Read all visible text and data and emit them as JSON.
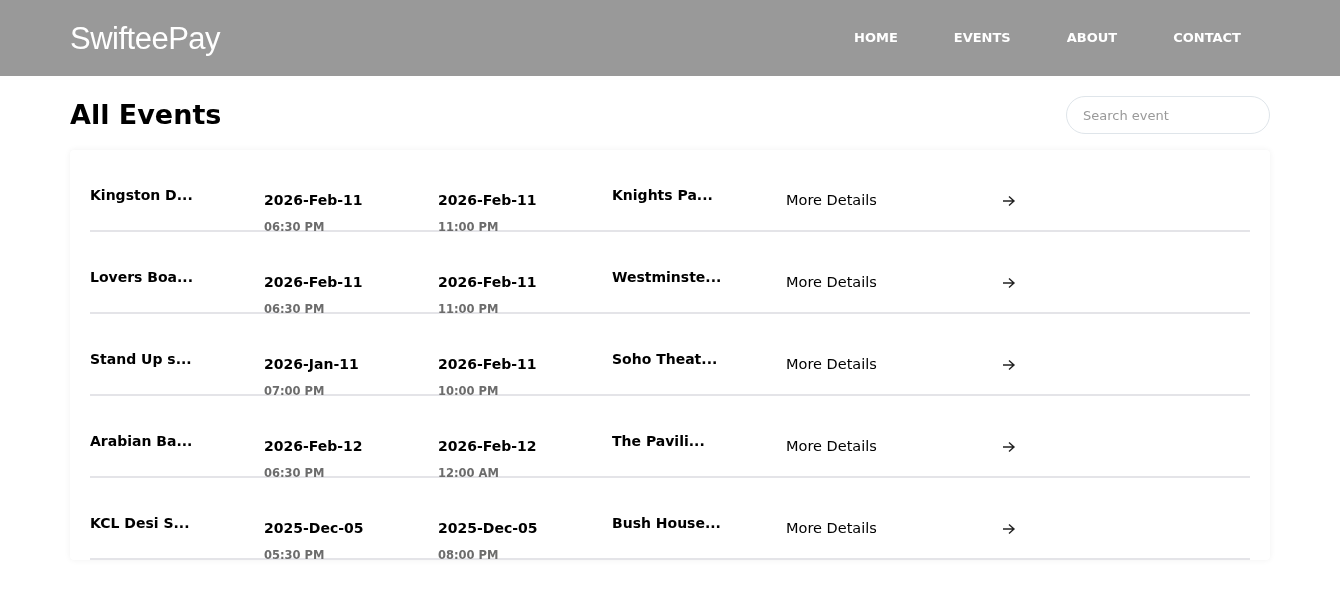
{
  "brand": "SwifteePay",
  "nav": [
    {
      "label": "HOME",
      "selected": false
    },
    {
      "label": "EVENTS",
      "selected": false
    },
    {
      "label": "ABOUT",
      "selected": false
    },
    {
      "label": "CONTACT",
      "selected": false
    }
  ],
  "page_title": "All Events",
  "search": {
    "placeholder": "Search event"
  },
  "events": [
    {
      "name": "Kingston D...",
      "start_date": "2026-Feb-11",
      "start_time": "06:30 PM",
      "end_date": "2026-Feb-11",
      "end_time": "11:00 PM",
      "venue": "Knights Pa...",
      "link": "More Details"
    },
    {
      "name": "Lovers Boa...",
      "start_date": "2026-Feb-11",
      "start_time": "06:30 PM",
      "end_date": "2026-Feb-11",
      "end_time": "11:00 PM",
      "venue": "Westminste...",
      "link": "More Details"
    },
    {
      "name": "Stand Up s...",
      "start_date": "2026-Jan-11",
      "start_time": "07:00 PM",
      "end_date": "2026-Feb-11",
      "end_time": "10:00 PM",
      "venue": "Soho Theat...",
      "link": "More Details"
    },
    {
      "name": "Arabian Ba...",
      "start_date": "2026-Feb-12",
      "start_time": "06:30 PM",
      "end_date": "2026-Feb-12",
      "end_time": "12:00 AM",
      "venue": "The Pavili...",
      "link": "More Details"
    },
    {
      "name": "KCL Desi S...",
      "start_date": "2025-Dec-05",
      "start_time": "05:30 PM",
      "end_date": "2025-Dec-05",
      "end_time": "08:00 PM",
      "venue": "Bush House...",
      "link": "More Details"
    }
  ]
}
